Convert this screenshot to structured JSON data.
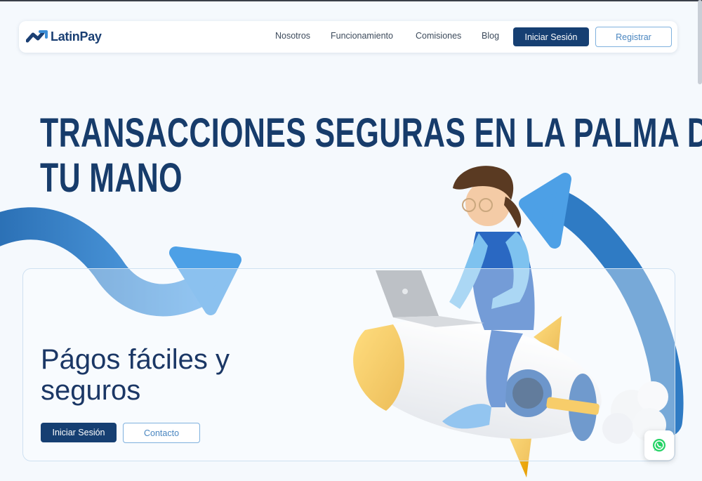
{
  "brand": {
    "name": "LatinPay",
    "color": "#1a3f73",
    "accent": "#4a86c0"
  },
  "nav": {
    "links": [
      "Nosotros",
      "Funcionamiento",
      "Comisiones",
      "Blog"
    ],
    "login_label": "Iniciar Sesión",
    "register_label": "Registrar"
  },
  "hero": {
    "title_line1": "TRANSACCIONES SEGURAS EN LA PALMA DE",
    "title_line2": "TU MANO"
  },
  "card": {
    "heading_line1": "Págos fáciles y",
    "heading_line2": "seguros",
    "login_label": "Iniciar Sesión",
    "contact_label": "Contacto"
  },
  "icons": {
    "logo": "latinpay-logo-icon",
    "whatsapp": "whatsapp-icon",
    "illustration": "girl-on-rocket-illustration"
  }
}
